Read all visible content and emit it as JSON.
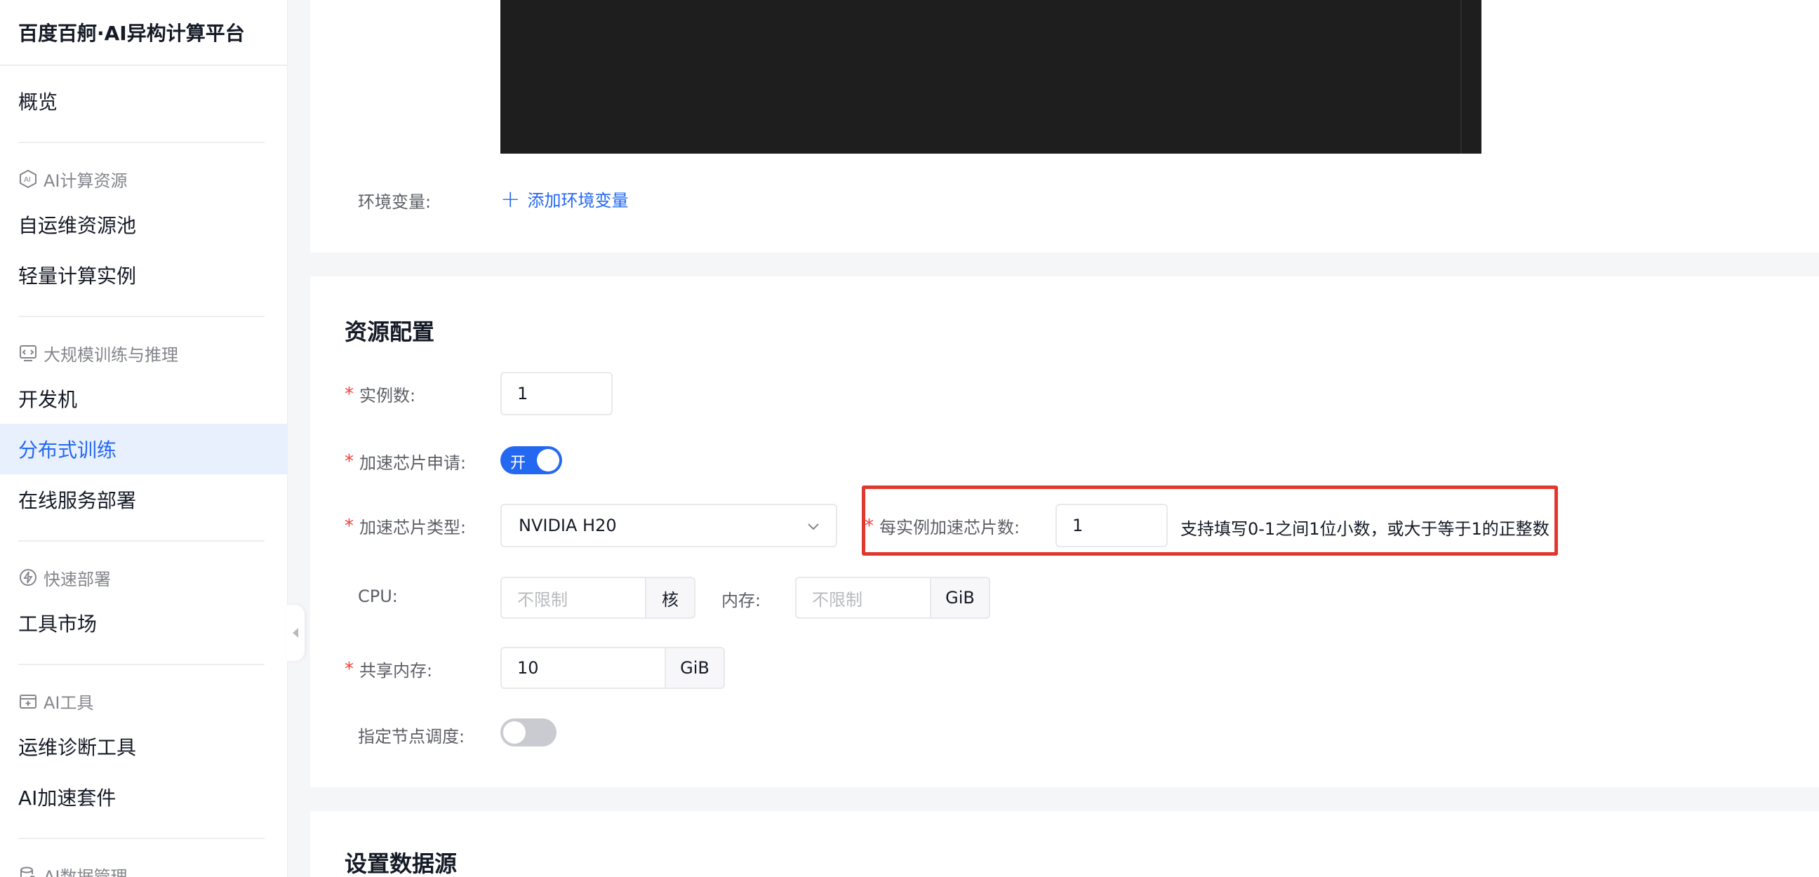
{
  "sidebar": {
    "brand": "百度百舸·AI异构计算平台",
    "overview": "概览",
    "group_compute": "AI计算资源",
    "item_pool": "自运维资源池",
    "item_light": "轻量计算实例",
    "group_train": "大规模训练与推理",
    "item_dev": "开发机",
    "item_dist": "分布式训练",
    "item_online": "在线服务部署",
    "group_quick": "快速部署",
    "item_market": "工具市场",
    "group_tools": "AI工具",
    "item_diag": "运维诊断工具",
    "item_accel": "AI加速套件",
    "group_data": "AI数据管理"
  },
  "env": {
    "label": "环境变量:",
    "add_link": "添加环境变量"
  },
  "resource": {
    "title": "资源配置",
    "instances_label": "实例数:",
    "instances_value": "1",
    "chip_request_label": "加速芯片申请:",
    "chip_request_toggle": "开",
    "chip_type_label": "加速芯片类型:",
    "chip_type_value": "NVIDIA H20",
    "per_instance_label": "每实例加速芯片数:",
    "per_instance_value": "1",
    "per_instance_hint": "支持填写0-1之间1位小数，或大于等于1的正整数",
    "cpu_label": "CPU:",
    "cpu_placeholder": "不限制",
    "cpu_unit": "核",
    "mem_label": "内存:",
    "mem_placeholder": "不限制",
    "mem_unit": "GiB",
    "shm_label": "共享内存:",
    "shm_value": "10",
    "shm_unit": "GiB",
    "node_sched_label": "指定节点调度:"
  },
  "datasource": {
    "title": "设置数据源"
  },
  "colors": {
    "primary": "#2468f2",
    "required": "#f33e3e",
    "highlight": "#e0382f",
    "terminal": "#1e1e1e"
  }
}
